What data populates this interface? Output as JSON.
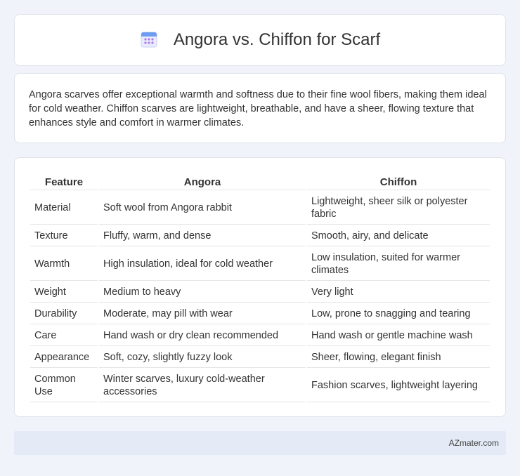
{
  "header": {
    "icon": "calendar-icon",
    "title": "Angora vs. Chiffon for Scarf"
  },
  "description": "Angora scarves offer exceptional warmth and softness due to their fine wool fibers, making them ideal for cold weather. Chiffon scarves are lightweight, breathable, and have a sheer, flowing texture that enhances style and comfort in warmer climates.",
  "table": {
    "headers": [
      "Feature",
      "Angora",
      "Chiffon"
    ],
    "rows": [
      [
        "Material",
        "Soft wool from Angora rabbit",
        "Lightweight, sheer silk or polyester fabric"
      ],
      [
        "Texture",
        "Fluffy, warm, and dense",
        "Smooth, airy, and delicate"
      ],
      [
        "Warmth",
        "High insulation, ideal for cold weather",
        "Low insulation, suited for warmer climates"
      ],
      [
        "Weight",
        "Medium to heavy",
        "Very light"
      ],
      [
        "Durability",
        "Moderate, may pill with wear",
        "Low, prone to snagging and tearing"
      ],
      [
        "Care",
        "Hand wash or dry clean recommended",
        "Hand wash or gentle machine wash"
      ],
      [
        "Appearance",
        "Soft, cozy, slightly fuzzy look",
        "Sheer, flowing, elegant finish"
      ],
      [
        "Common Use",
        "Winter scarves, luxury cold-weather accessories",
        "Fashion scarves, lightweight layering"
      ]
    ]
  },
  "footer": {
    "text": "AZmater.com"
  },
  "colors": {
    "background": "#f0f3f9",
    "card": "#ffffff",
    "footer_bg": "#e4ebf7",
    "icon_accent": "#7b8cf0"
  }
}
